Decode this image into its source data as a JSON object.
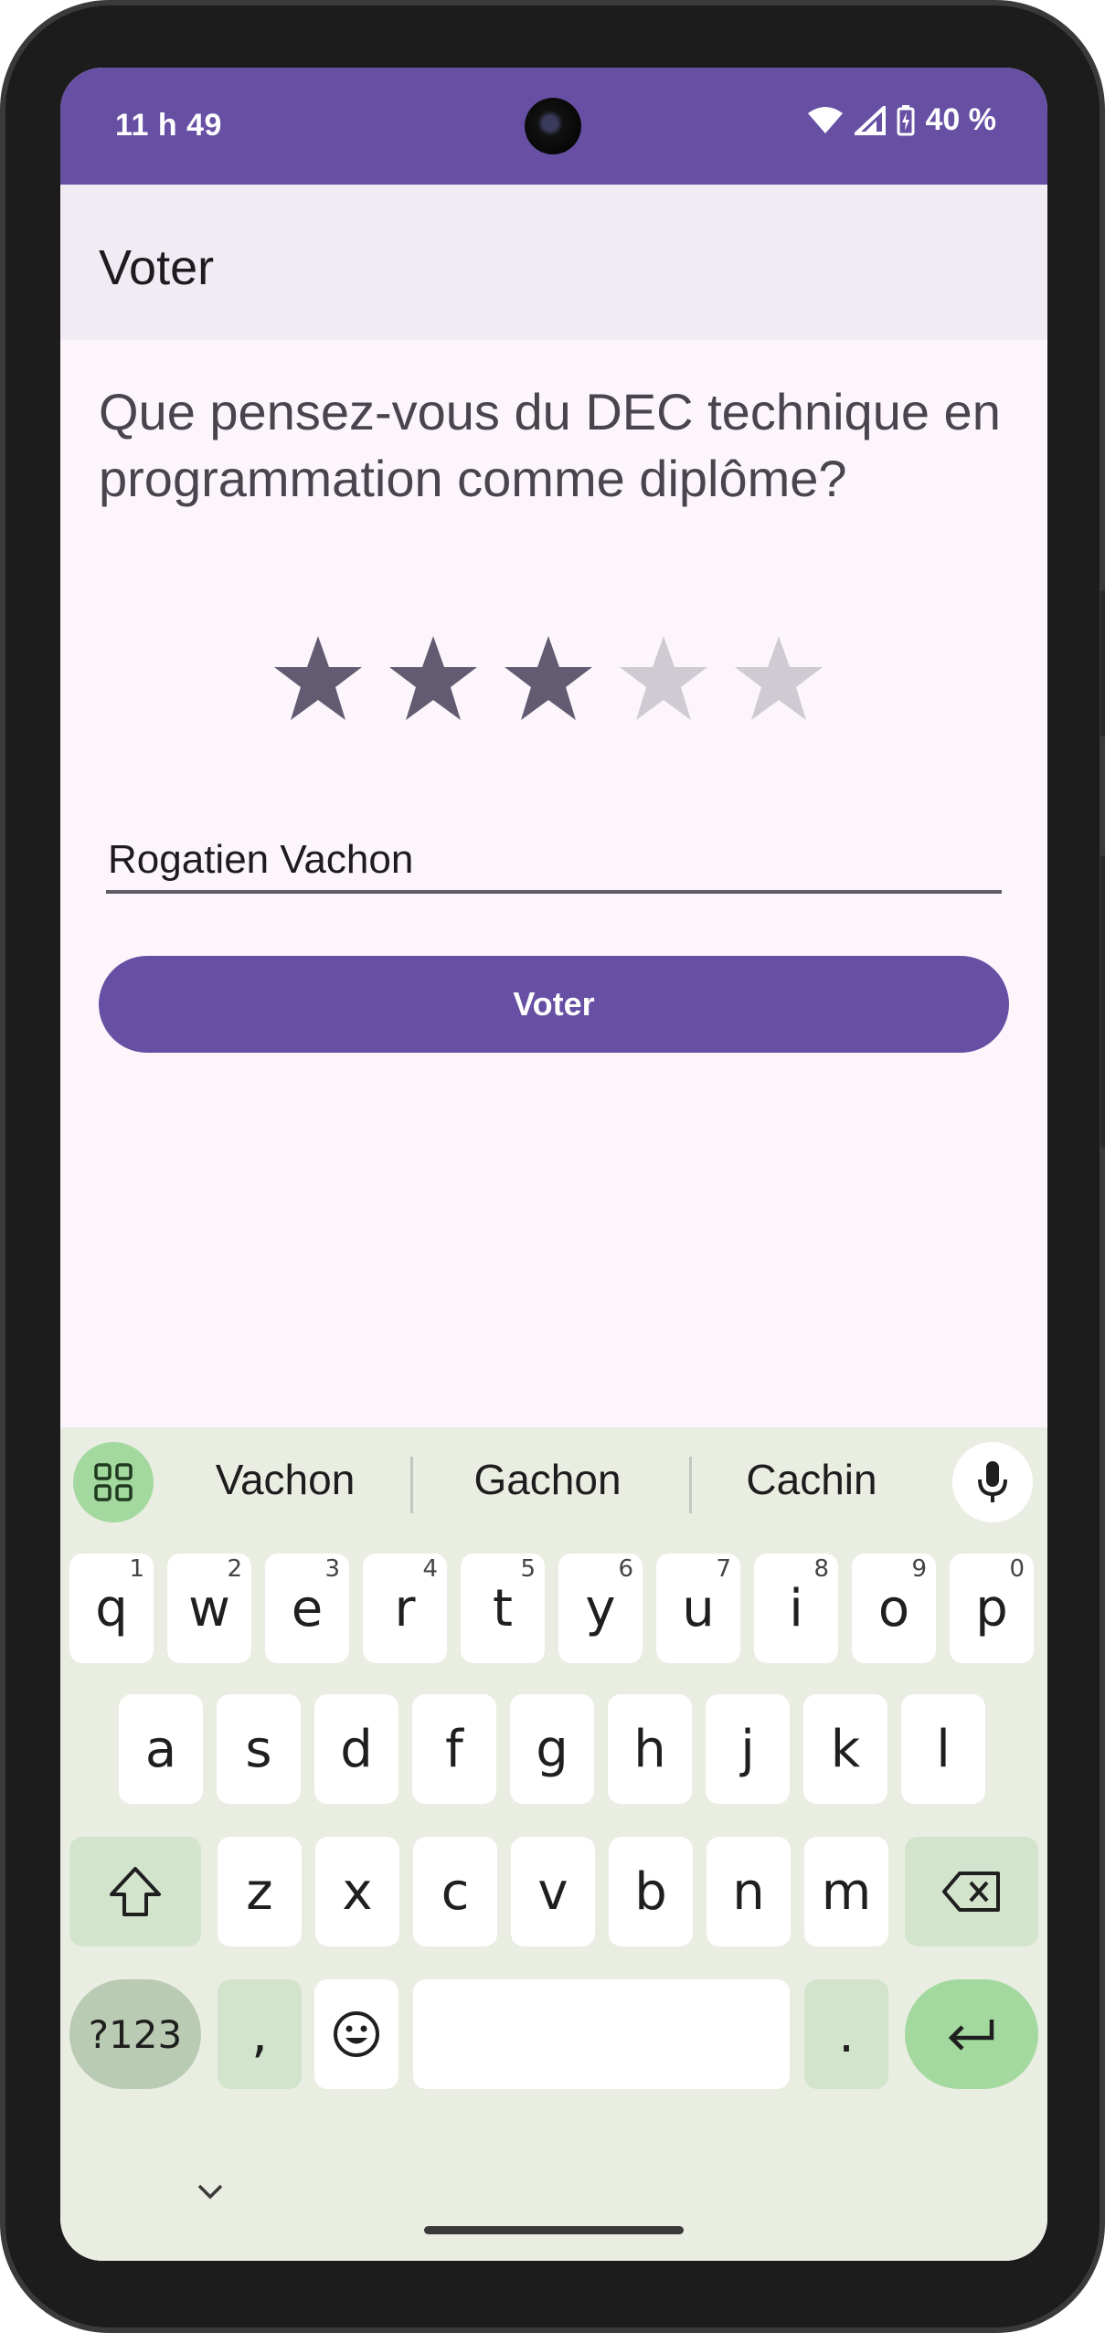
{
  "status_bar": {
    "time": "11 h 49",
    "battery": "40 %"
  },
  "app_bar": {
    "title": "Voter"
  },
  "form": {
    "question": "Que pensez-vous du DEC technique en programmation comme diplôme?",
    "rating": {
      "value": 3,
      "max": 5
    },
    "name_value": "Rogatien Vachon",
    "submit_label": "Voter"
  },
  "keyboard": {
    "suggestions": [
      "Vachon",
      "Gachon",
      "Cachin"
    ],
    "row1": [
      {
        "k": "q",
        "h": "1"
      },
      {
        "k": "w",
        "h": "2"
      },
      {
        "k": "e",
        "h": "3"
      },
      {
        "k": "r",
        "h": "4"
      },
      {
        "k": "t",
        "h": "5"
      },
      {
        "k": "y",
        "h": "6"
      },
      {
        "k": "u",
        "h": "7"
      },
      {
        "k": "i",
        "h": "8"
      },
      {
        "k": "o",
        "h": "9"
      },
      {
        "k": "p",
        "h": "0"
      }
    ],
    "row2": [
      "a",
      "s",
      "d",
      "f",
      "g",
      "h",
      "j",
      "k",
      "l"
    ],
    "row3": [
      "z",
      "x",
      "c",
      "v",
      "b",
      "n",
      "m"
    ],
    "symbols_label": "?123",
    "comma": ",",
    "period": "."
  },
  "colors": {
    "primary": "#6750a4",
    "star_filled": "#625b71",
    "star_empty": "#cfcbd3"
  }
}
